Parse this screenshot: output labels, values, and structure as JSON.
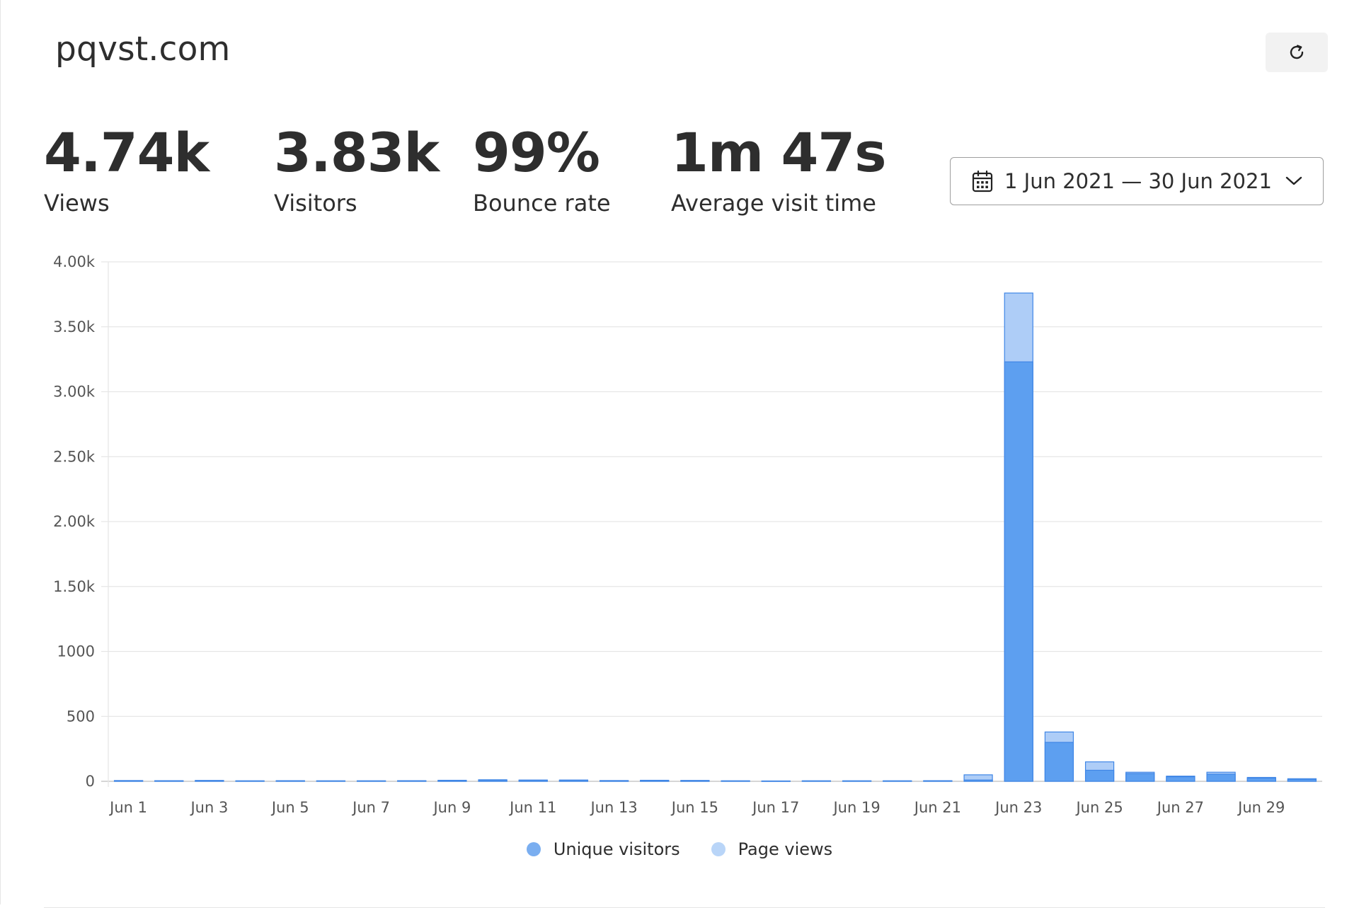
{
  "site": {
    "title": "pqvst.com"
  },
  "metrics": [
    {
      "value": "4.74k",
      "label": "Views"
    },
    {
      "value": "3.83k",
      "label": "Visitors"
    },
    {
      "value": "99%",
      "label": "Bounce rate"
    },
    {
      "value": "1m 47s",
      "label": "Average visit time"
    }
  ],
  "date_range": {
    "text": "1 Jun 2021 — 30 Jun 2021"
  },
  "icons": {
    "refresh": "refresh-icon",
    "calendar": "calendar-icon",
    "chevron": "chevron-down-icon"
  },
  "colors": {
    "unique_visitors": "#5d9ff0",
    "page_views": "#aecdf7",
    "bar_stroke": "#3f86e6",
    "grid": "#e6e6e6"
  },
  "legend": [
    {
      "label": "Unique visitors",
      "color": "#7aaef0"
    },
    {
      "label": "Page views",
      "color": "#b9d5f8"
    }
  ],
  "chart_data": {
    "type": "bar",
    "stacked": "overlay",
    "categories": [
      "Jun 1",
      "Jun 2",
      "Jun 3",
      "Jun 4",
      "Jun 5",
      "Jun 6",
      "Jun 7",
      "Jun 8",
      "Jun 9",
      "Jun 10",
      "Jun 11",
      "Jun 12",
      "Jun 13",
      "Jun 14",
      "Jun 15",
      "Jun 16",
      "Jun 17",
      "Jun 18",
      "Jun 19",
      "Jun 20",
      "Jun 21",
      "Jun 22",
      "Jun 23",
      "Jun 24",
      "Jun 25",
      "Jun 26",
      "Jun 27",
      "Jun 28",
      "Jun 29",
      "Jun 30"
    ],
    "x_tick_labels": [
      "Jun 1",
      "Jun 3",
      "Jun 5",
      "Jun 7",
      "Jun 9",
      "Jun 11",
      "Jun 13",
      "Jun 15",
      "Jun 17",
      "Jun 19",
      "Jun 21",
      "Jun 23",
      "Jun 25",
      "Jun 27",
      "Jun 29"
    ],
    "y_ticks": [
      0,
      500,
      1000,
      1500,
      2000,
      2500,
      3000,
      3500,
      4000
    ],
    "y_tick_labels": [
      "0",
      "500",
      "1000",
      "1.50k",
      "2.00k",
      "2.50k",
      "3.00k",
      "3.50k",
      "4.00k"
    ],
    "ylim": [
      0,
      4000
    ],
    "series": [
      {
        "name": "Unique visitors",
        "values": [
          5,
          4,
          5,
          3,
          4,
          3,
          3,
          4,
          6,
          9,
          8,
          8,
          5,
          6,
          5,
          3,
          2,
          3,
          3,
          3,
          4,
          10,
          3230,
          300,
          85,
          60,
          35,
          55,
          25,
          15
        ]
      },
      {
        "name": "Page views",
        "values": [
          6,
          5,
          7,
          4,
          5,
          4,
          4,
          5,
          8,
          12,
          10,
          10,
          6,
          8,
          7,
          4,
          3,
          4,
          4,
          4,
          5,
          50,
          3760,
          380,
          150,
          70,
          40,
          70,
          30,
          20
        ]
      }
    ],
    "grid": true,
    "legend_position": "bottom"
  }
}
